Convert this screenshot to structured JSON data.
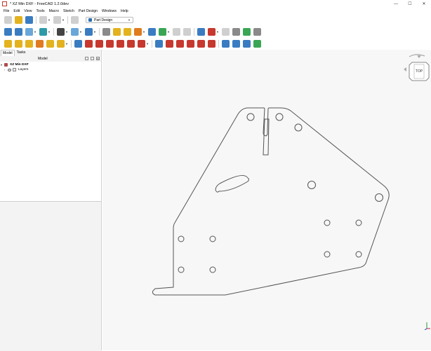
{
  "window": {
    "title": "* XZ Min DXF - FreeCAD 1.2.0dev",
    "controls": {
      "minimize": "—",
      "maximize": "☐",
      "close": "✕"
    }
  },
  "menu": [
    "File",
    "Edit",
    "View",
    "Tools",
    "Macro",
    "Sketch",
    "Part Design",
    "Windows",
    "Help"
  ],
  "workbench": {
    "selected": "Part Design"
  },
  "left_panel": {
    "tabs": [
      "Model",
      "Tasks"
    ],
    "header": "Model",
    "tree": {
      "document": "XZ Min DXF",
      "layers": "Layers"
    }
  },
  "navcube": {
    "face": "TOP"
  },
  "colors": {
    "view_bg": "#f7f7f7",
    "panel_bg": "#f3f3f3",
    "sketch_line": "#555555"
  }
}
